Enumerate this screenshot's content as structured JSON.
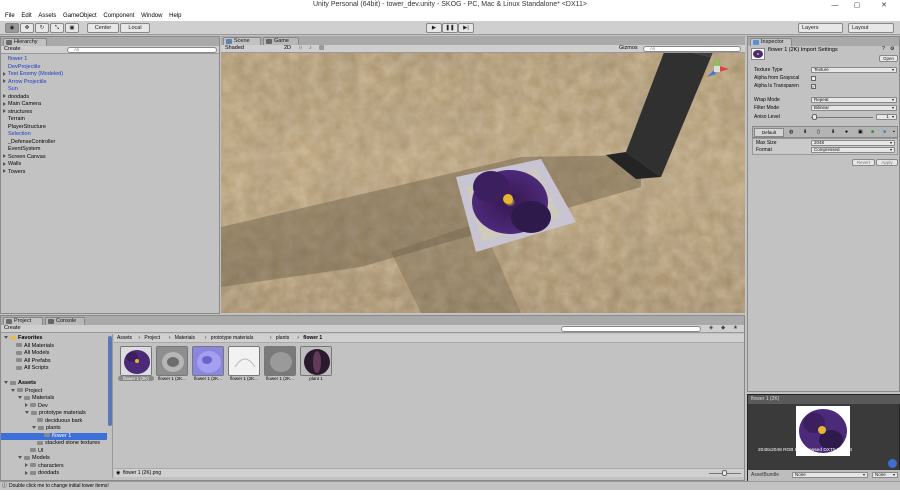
{
  "window": {
    "title": "Unity Personal (64bit) - tower_dev.unity - SKOG - PC, Mac & Linux Standalone* <DX11>",
    "min": "—",
    "max": "▢",
    "close": "✕"
  },
  "menu": [
    "File",
    "Edit",
    "Assets",
    "GameObject",
    "Component",
    "Window",
    "Help"
  ],
  "toolbar": {
    "pivot": "Center",
    "space": "Local",
    "layers": "Layers",
    "layout": "Layout"
  },
  "hierarchy": {
    "tab": "Hierarchy",
    "create": "Create",
    "items": [
      {
        "label": "flower 1",
        "style": "blue",
        "indent": 0,
        "arrow": ""
      },
      {
        "label": "DevProjectile",
        "style": "blue",
        "indent": 0,
        "arrow": ""
      },
      {
        "label": "Test Enemy (Modeled)",
        "style": "blue",
        "indent": 0,
        "arrow": "closed"
      },
      {
        "label": "Arrow Projectile",
        "style": "blue",
        "indent": 0,
        "arrow": "closed"
      },
      {
        "label": "Sun",
        "style": "blue",
        "indent": 0,
        "arrow": ""
      },
      {
        "label": "doodads",
        "style": "",
        "indent": 0,
        "arrow": "closed"
      },
      {
        "label": "Main Camera",
        "style": "",
        "indent": 0,
        "arrow": "closed"
      },
      {
        "label": "structures",
        "style": "",
        "indent": 0,
        "arrow": "closed"
      },
      {
        "label": "Terrain",
        "style": "",
        "indent": 0,
        "arrow": ""
      },
      {
        "label": "PlayerStructure",
        "style": "",
        "indent": 0,
        "arrow": ""
      },
      {
        "label": "Selection",
        "style": "blue",
        "indent": 0,
        "arrow": ""
      },
      {
        "label": "_DefenseController",
        "style": "",
        "indent": 0,
        "arrow": ""
      },
      {
        "label": "EventSystem",
        "style": "",
        "indent": 0,
        "arrow": ""
      },
      {
        "label": "Screen Canvas",
        "style": "",
        "indent": 0,
        "arrow": "closed"
      },
      {
        "label": "Walls",
        "style": "",
        "indent": 0,
        "arrow": "closed"
      },
      {
        "label": "Towers",
        "style": "",
        "indent": 0,
        "arrow": "closed"
      }
    ]
  },
  "scene": {
    "tab_scene": "Scene",
    "tab_game": "Game",
    "shading": "Shaded",
    "mode2d": "2D",
    "gizmos": "Gizmos"
  },
  "inspector": {
    "tab": "Inspector",
    "title": "flower 1 (2K) Import Settings",
    "open": "Open",
    "texture_type_label": "Texture Type",
    "texture_type": "Texture",
    "alpha_gray_label": "Alpha from Grayscal",
    "alpha_transp_label": "Alpha Is Transparen",
    "wrap_label": "Wrap Mode",
    "wrap": "Repeat",
    "filter_label": "Filter Mode",
    "filter": "Bilinear",
    "aniso_label": "Aniso Level",
    "aniso": "1",
    "platform_default": "Default",
    "maxsize_label": "Max Size",
    "maxsize": "2048",
    "format_label": "Format",
    "format": "Compressed",
    "revert": "Revert",
    "apply": "Apply"
  },
  "project": {
    "tab_project": "Project",
    "tab_console": "Console",
    "create": "Create",
    "tree": [
      {
        "label": "Favorites",
        "indent": 0,
        "arrow": "open",
        "folder": "yel",
        "bold": true
      },
      {
        "label": "All Materials",
        "indent": 1,
        "arrow": "",
        "folder": "gray"
      },
      {
        "label": "All Models",
        "indent": 1,
        "arrow": "",
        "folder": "gray"
      },
      {
        "label": "All Prefabs",
        "indent": 1,
        "arrow": "",
        "folder": "gray"
      },
      {
        "label": "All Scripts",
        "indent": 1,
        "arrow": "",
        "folder": "gray"
      },
      {
        "label": "",
        "indent": 0,
        "arrow": "",
        "folder": ""
      },
      {
        "label": "Assets",
        "indent": 0,
        "arrow": "open",
        "folder": "gray",
        "bold": true
      },
      {
        "label": "Project",
        "indent": 1,
        "arrow": "open",
        "folder": "gray"
      },
      {
        "label": "Materials",
        "indent": 2,
        "arrow": "open",
        "folder": "gray"
      },
      {
        "label": "Dev",
        "indent": 3,
        "arrow": "closed",
        "folder": "gray"
      },
      {
        "label": "prototype materials",
        "indent": 3,
        "arrow": "open",
        "folder": "gray"
      },
      {
        "label": "deciduous bark",
        "indent": 4,
        "arrow": "",
        "folder": "gray"
      },
      {
        "label": "plants",
        "indent": 4,
        "arrow": "open",
        "folder": "gray"
      },
      {
        "label": "flower 1",
        "indent": 5,
        "arrow": "",
        "folder": "gray",
        "selected": true
      },
      {
        "label": "stacked stone textures",
        "indent": 4,
        "arrow": "",
        "folder": "gray"
      },
      {
        "label": "UI",
        "indent": 3,
        "arrow": "",
        "folder": "gray"
      },
      {
        "label": "Models",
        "indent": 2,
        "arrow": "open",
        "folder": "gray"
      },
      {
        "label": "characters",
        "indent": 3,
        "arrow": "closed",
        "folder": "gray"
      },
      {
        "label": "doodads",
        "indent": 3,
        "arrow": "closed",
        "folder": "gray"
      }
    ],
    "breadcrumb": [
      "Assets",
      "Project",
      "Materials",
      "prototype materials",
      "plants",
      "flower 1"
    ],
    "assets": [
      {
        "label": "flower 1 (2K)",
        "kind": "flower"
      },
      {
        "label": "flower 1 (2K...",
        "kind": "normalgray"
      },
      {
        "label": "flower 1 (2K...",
        "kind": "normalblue"
      },
      {
        "label": "flower 1 (2K...",
        "kind": "white"
      },
      {
        "label": "flower 1 (2K...",
        "kind": "gray"
      },
      {
        "label": "plant 1",
        "kind": "sphere"
      }
    ],
    "footer_file": "flower 1 (2K).png"
  },
  "preview": {
    "title": "flower 1 (2K)",
    "info": "2048x2048  RGB Compressed DXT5  5.3 MB",
    "assetbundle_label": "AssetBundle",
    "bundle": "None",
    "variant": "None"
  },
  "status": "Double click me to change initial tower items!",
  "colors": {
    "selection": "#3d6fd8",
    "hierarchy_blue": "#1d3cc4",
    "panel": "#c2c2c2"
  }
}
